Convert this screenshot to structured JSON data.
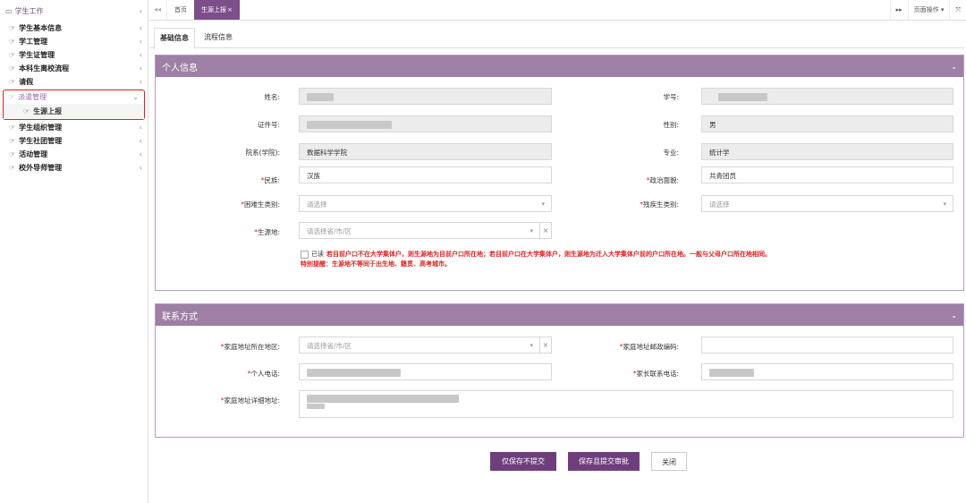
{
  "sidebar": {
    "header": {
      "icon": "monitor-icon",
      "label": "学生工作"
    },
    "items_top": [
      {
        "label": "学生基本信息"
      },
      {
        "label": "学工管理"
      },
      {
        "label": "学生证管理"
      },
      {
        "label": "本科生离校流程"
      },
      {
        "label": "请假"
      }
    ],
    "active_group": {
      "label": "派遣管理",
      "sub_label": "生源上报"
    },
    "items_bottom": [
      {
        "label": "学生组织管理"
      },
      {
        "label": "学生社团管理"
      },
      {
        "label": "活动管理"
      },
      {
        "label": "校外导师管理"
      }
    ],
    "chevron": "‹",
    "chevron_down": "⌄"
  },
  "tabbar": {
    "prev": "◂◂",
    "home": "首页",
    "active_tab": "生源上报",
    "close": "×",
    "next": "▸▸",
    "page_ops": "页面操作 ▾",
    "fullscreen": "⤧"
  },
  "subtabs": {
    "basic": "基础信息",
    "flow": "流程信息"
  },
  "personal": {
    "title": "个人信息",
    "name_label": "姓名:",
    "student_no_label": "学号:",
    "id_label": "证件号:",
    "gender_label": "性别:",
    "gender": "男",
    "dept_label": "院系(学院):",
    "dept": "数据科学学院",
    "major_label": "专业:",
    "major": "统计学",
    "ethnic_label": "民族:",
    "ethnic": "汉族",
    "political_label": "政治面貌:",
    "political": "共青团员",
    "hardship_label": "困难生类别:",
    "hardship_placeholder": "请选择",
    "disability_label": "残疾生类别:",
    "disability_placeholder": "请选择",
    "origin_label": "生源地:",
    "origin_placeholder": "请选择省/市/区",
    "read_label": "已读",
    "note_line1": "若目前户口不在大学集体户，则生源地为目前户口所在地；若目前户口在大学集体户，则生源地为迁入大学集体户前的户口所在地。一般与父母户口所在地相同。",
    "note_line2": "特别提醒：生源地不等同于出生地、籍贯、高考城市。"
  },
  "contact": {
    "title": "联系方式",
    "home_region_label": "家庭地址所在地区:",
    "home_region_placeholder": "请选择省/市/区",
    "postcode_label": "家庭地址邮政编码:",
    "phone_label": "个人电话:",
    "parent_phone_label": "家长联系电话:",
    "address_label": "家庭地址详细地址:"
  },
  "buttons": {
    "save_only": "仅保存不提交",
    "save_submit": "保存且提交审批",
    "close": "关闭"
  },
  "required_mark": "*",
  "clear": "×",
  "arrow": "▾",
  "panel_chevron": "⌄",
  "colors": {
    "accent": "#7d4f8a",
    "panel_header": "#9e7fa6",
    "required": "#e02020"
  }
}
